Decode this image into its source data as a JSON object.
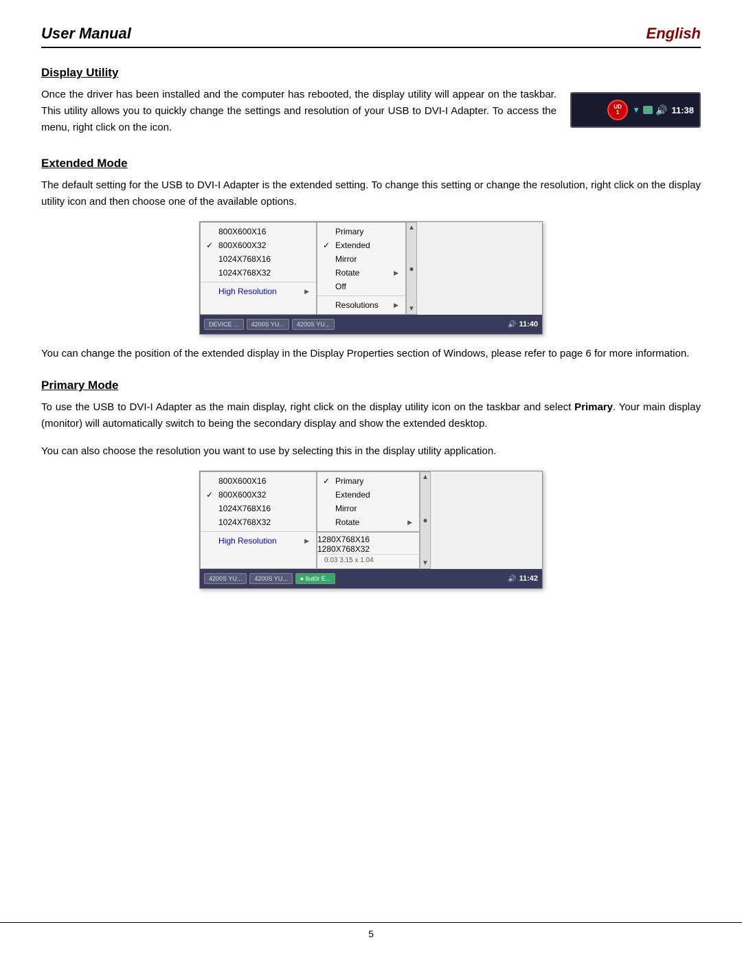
{
  "header": {
    "left": "User Manual",
    "right": "English"
  },
  "display_utility": {
    "title": "Display Utility",
    "text": "Once the driver has been installed and the computer has rebooted, the display utility will appear on the taskbar. This utility allows you to quickly change the settings and resolution of your USB to DVI-I Adapter. To access the menu, right click on the icon.",
    "taskbar": {
      "usb_label": "USB\n1",
      "time": "11:38"
    }
  },
  "extended_mode": {
    "title": "Extended Mode",
    "text": "The default setting for the USB to DVI-I Adapter is the extended setting. To change this setting or change the resolution, right click on the display utility icon and then choose one of the available options.",
    "note": "You can change the position of the extended display in the Display Properties section of Windows, please refer to page 6 for more information.",
    "menu": {
      "resolutions": [
        {
          "label": "800X600X16",
          "checked": false
        },
        {
          "label": "800X600X32",
          "checked": true
        },
        {
          "label": "1024X768X16",
          "checked": false
        },
        {
          "label": "1024X768X32",
          "checked": false
        }
      ],
      "high_resolution": "High Resolution",
      "options": [
        {
          "label": "Primary",
          "checked": false
        },
        {
          "label": "Extended",
          "checked": true
        },
        {
          "label": "Mirror",
          "checked": false
        },
        {
          "label": "Rotate",
          "has_arrow": true
        },
        {
          "label": "Off",
          "checked": false
        },
        {
          "label": "Resolutions",
          "has_arrow": true
        }
      ],
      "taskbar_time": "11:40"
    }
  },
  "primary_mode": {
    "title": "Primary Mode",
    "text1": "To use the USB to DVI-I Adapter as the main display, right click on the display utility icon on the taskbar and select Primary. Your main display (monitor) will automatically switch to being the secondary display and show the extended desktop.",
    "text2": "You can also choose the resolution you want to use by selecting this in the display utility application.",
    "menu": {
      "resolutions": [
        {
          "label": "800X600X16",
          "checked": false
        },
        {
          "label": "800X600X32",
          "checked": true
        },
        {
          "label": "1024X768X16",
          "checked": false
        },
        {
          "label": "1024X768X32",
          "checked": false
        }
      ],
      "high_resolution": "High Resolution",
      "options": [
        {
          "label": "Primary",
          "checked": true
        },
        {
          "label": "Extended",
          "checked": false
        },
        {
          "label": "Mirror",
          "checked": false
        },
        {
          "label": "Rotate",
          "has_arrow": true
        }
      ],
      "sub_resolutions": [
        "1280X768X16",
        "1280X768X32"
      ],
      "taskbar_time": "11:42",
      "size_note": "0.03   3.15 x 1.04"
    }
  },
  "footer": {
    "page_number": "5"
  }
}
